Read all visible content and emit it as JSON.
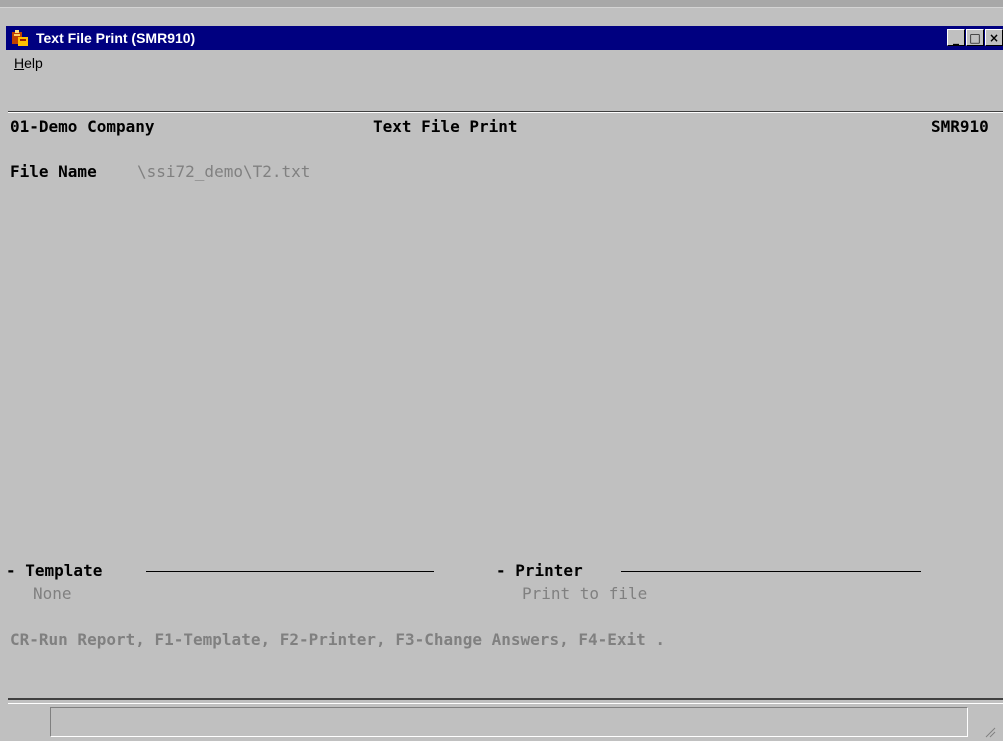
{
  "window": {
    "title": "Text File Print (SMR910)",
    "minimize_label": "_",
    "maximize_label": "□",
    "close_label": "×"
  },
  "menu": {
    "help_mnemonic": "H",
    "help_rest": "elp"
  },
  "header": {
    "company": "01-Demo Company",
    "title": "Text File Print",
    "program_code": "SMR910"
  },
  "form": {
    "file_name_label": "File Name",
    "file_name_value": "\\ssi72_demo\\T2.txt"
  },
  "template": {
    "title": "Template",
    "value": "None"
  },
  "printer": {
    "title": "Printer",
    "value": "Print to file"
  },
  "commands": "CR-Run Report, F1-Template, F2-Printer, F3-Change Answers, F4-Exit .",
  "status_bar": {
    "text": ""
  },
  "colors": {
    "titlebar": "#000080",
    "background": "#c0c0c0",
    "dim_text": "#808080"
  },
  "icons": {
    "app": "app-icon",
    "grip": "resize-grip-icon"
  }
}
